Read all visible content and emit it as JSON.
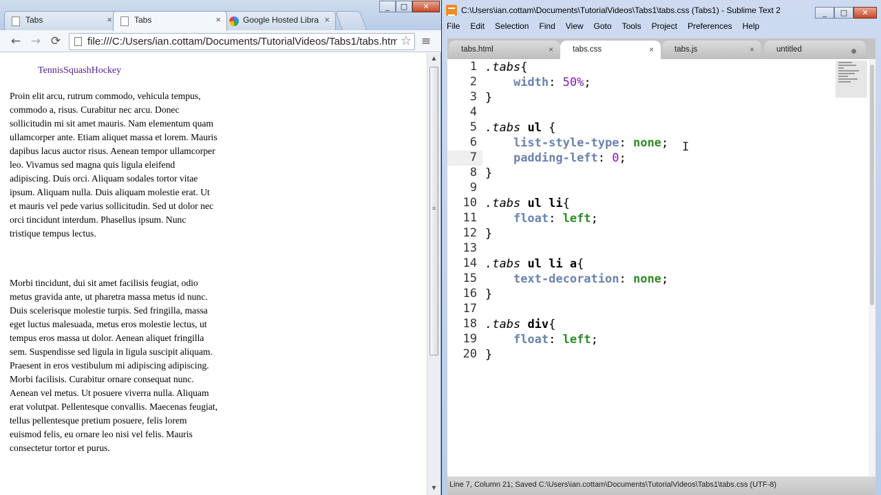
{
  "chrome": {
    "win_min": "_",
    "win_max": "□",
    "win_close": "✕",
    "tabs": [
      {
        "label": "Tabs",
        "close": "×"
      },
      {
        "label": "Tabs",
        "close": "×"
      },
      {
        "label": "Google Hosted Libra",
        "close": "×"
      }
    ],
    "toolbar": {
      "back": "←",
      "forward": "→",
      "reload": "⟳",
      "menu": "≡",
      "star": "☆"
    },
    "url": "file:///C:/Users/ian.cottam/Documents/TutorialVideos/Tabs1/tabs.html",
    "page": {
      "tab_links": [
        "Tennis",
        "Squash",
        "Hockey"
      ],
      "para1": "Proin elit arcu, rutrum commodo, vehicula tempus, commodo a, risus. Curabitur nec arcu. Donec sollicitudin mi sit amet mauris. Nam elementum quam ullamcorper ante. Etiam aliquet massa et lorem. Mauris dapibus lacus auctor risus. Aenean tempor ullamcorper leo. Vivamus sed magna quis ligula eleifend adipiscing. Duis orci. Aliquam sodales tortor vitae ipsum. Aliquam nulla. Duis aliquam molestie erat. Ut et mauris vel pede varius sollicitudin. Sed ut dolor nec orci tincidunt interdum. Phasellus ipsum. Nunc tristique tempus lectus.",
      "para2": "Morbi tincidunt, dui sit amet facilisis feugiat, odio metus gravida ante, ut pharetra massa metus id nunc. Duis scelerisque molestie turpis. Sed fringilla, massa eget luctus malesuada, metus eros molestie lectus, ut tempus eros massa ut dolor. Aenean aliquet fringilla sem. Suspendisse sed ligula in ligula suscipit aliquam. Praesent in eros vestibulum mi adipiscing adipiscing. Morbi facilisis. Curabitur ornare consequat nunc. Aenean vel metus. Ut posuere viverra nulla. Aliquam erat volutpat. Pellentesque convallis. Maecenas feugiat, tellus pellentesque pretium posuere, felis lorem euismod felis, eu ornare leo nisi vel felis. Mauris consectetur tortor et purus."
    },
    "scroll_up": "▲",
    "scroll_mid": "≡",
    "scroll_down": "▼"
  },
  "sublime": {
    "title": "C:\\Users\\ian.cottam\\Documents\\TutorialVideos\\Tabs1\\tabs.css (Tabs1) - Sublime Text 2",
    "win_min": "_",
    "win_max": "□",
    "win_close": "✕",
    "menu": [
      "File",
      "Edit",
      "Selection",
      "Find",
      "View",
      "Goto",
      "Tools",
      "Project",
      "Preferences",
      "Help"
    ],
    "tabs": [
      {
        "label": "tabs.html",
        "close": "×"
      },
      {
        "label": "tabs.css",
        "close": "×"
      },
      {
        "label": "tabs.js",
        "close": "×"
      },
      {
        "label": "untitled"
      }
    ],
    "active_line": 7,
    "code": [
      [
        [
          "sel",
          ".tabs"
        ],
        [
          "punc",
          "{"
        ]
      ],
      [
        [
          "ind",
          "    "
        ],
        [
          "prop",
          "width"
        ],
        [
          "punc",
          ": "
        ],
        [
          "num",
          "50%"
        ],
        [
          "punc",
          ";"
        ]
      ],
      [
        [
          "punc",
          "}"
        ]
      ],
      [],
      [
        [
          "sel",
          ".tabs"
        ],
        [
          "punc",
          " "
        ],
        [
          "tag",
          "ul"
        ],
        [
          "punc",
          " {"
        ]
      ],
      [
        [
          "ind",
          "    "
        ],
        [
          "prop",
          "list-style-type"
        ],
        [
          "punc",
          ": "
        ],
        [
          "val",
          "none"
        ],
        [
          "punc",
          ";"
        ]
      ],
      [
        [
          "ind",
          "    "
        ],
        [
          "prop",
          "padding-left"
        ],
        [
          "punc",
          ": "
        ],
        [
          "num",
          "0"
        ],
        [
          "punc",
          ";"
        ]
      ],
      [
        [
          "punc",
          "}"
        ]
      ],
      [],
      [
        [
          "sel",
          ".tabs"
        ],
        [
          "punc",
          " "
        ],
        [
          "tag",
          "ul li"
        ],
        [
          "punc",
          "{"
        ]
      ],
      [
        [
          "ind",
          "    "
        ],
        [
          "prop",
          "float"
        ],
        [
          "punc",
          ": "
        ],
        [
          "val",
          "left"
        ],
        [
          "punc",
          ";"
        ]
      ],
      [
        [
          "punc",
          "}"
        ]
      ],
      [],
      [
        [
          "sel",
          ".tabs"
        ],
        [
          "punc",
          " "
        ],
        [
          "tag",
          "ul li a"
        ],
        [
          "punc",
          "{"
        ]
      ],
      [
        [
          "ind",
          "    "
        ],
        [
          "prop",
          "text-decoration"
        ],
        [
          "punc",
          ": "
        ],
        [
          "val",
          "none"
        ],
        [
          "punc",
          ";"
        ]
      ],
      [
        [
          "punc",
          "}"
        ]
      ],
      [],
      [
        [
          "sel",
          ".tabs"
        ],
        [
          "punc",
          " "
        ],
        [
          "tag",
          "div"
        ],
        [
          "punc",
          "{"
        ]
      ],
      [
        [
          "ind",
          "    "
        ],
        [
          "prop",
          "float"
        ],
        [
          "punc",
          ": "
        ],
        [
          "val",
          "left"
        ],
        [
          "punc",
          ";"
        ]
      ],
      [
        [
          "punc",
          "}"
        ]
      ]
    ],
    "ibeam": "I",
    "status": "Line 7, Column 21; Saved C:\\Users\\ian.cottam\\Documents\\TutorialVideos\\Tabs1\\tabs.css (UTF-8)"
  }
}
